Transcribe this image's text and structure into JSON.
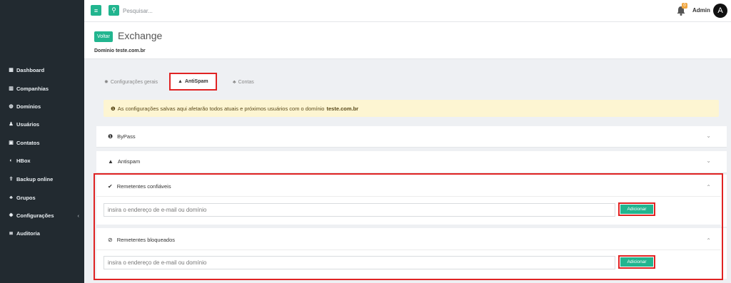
{
  "sidebar": {
    "items": [
      {
        "icon": "dashboard-icon",
        "glyph": "▦",
        "label": "Dashboard"
      },
      {
        "icon": "building-icon",
        "glyph": "▥",
        "label": "Companhias"
      },
      {
        "icon": "globe-icon",
        "glyph": "◍",
        "label": "Domínios"
      },
      {
        "icon": "user-icon",
        "glyph": "♟",
        "label": "Usuários"
      },
      {
        "icon": "address-card-icon",
        "glyph": "▣",
        "label": "Contatos"
      },
      {
        "icon": "hbox-icon",
        "glyph": "◐",
        "label": "HBox"
      },
      {
        "icon": "upload-icon",
        "glyph": "⇪",
        "label": "Backup online"
      },
      {
        "icon": "users-icon",
        "glyph": "♣",
        "label": "Grupos"
      },
      {
        "icon": "gear-icon",
        "glyph": "✹",
        "label": "Configurações",
        "chevron": "‹"
      },
      {
        "icon": "list-icon",
        "glyph": "≣",
        "label": "Auditoria"
      }
    ]
  },
  "topbar": {
    "menu_glyph": "≡",
    "search_glyph": "⚲",
    "search_placeholder": "Pesquisar...",
    "notification_count": "0",
    "user_name": "Admin",
    "avatar_letter": "A"
  },
  "header": {
    "back_label": "Voltar",
    "title": "Exchange",
    "domain_line": "Domínio teste.com.br"
  },
  "tabs": [
    {
      "icon": "gear-icon",
      "glyph": "✹",
      "label": "Configurações gerais",
      "active": false
    },
    {
      "icon": "warning-icon",
      "glyph": "▲",
      "label": "AntiSpam",
      "active": true
    },
    {
      "icon": "users-icon",
      "glyph": "♣",
      "label": "Contas",
      "active": false
    }
  ],
  "alert": {
    "glyph": "❶",
    "text": "As configurações salvas aqui afetarão todos atuais e próximos usuários com o domínio",
    "domain": "teste.com.br"
  },
  "panels": {
    "bypass": {
      "glyph": "❶",
      "title": "ByPass",
      "chevron": "⌄"
    },
    "antispam": {
      "glyph": "▲",
      "title": "Antispam",
      "chevron": "⌄"
    },
    "trusted": {
      "glyph": "✔",
      "title": "Remetentes confiáveis",
      "chevron": "⌃",
      "placeholder": "insira o endereço de e-mail ou domínio",
      "button": "Adicionar"
    },
    "blocked": {
      "glyph": "⊘",
      "title": "Remetentes bloqueados",
      "chevron": "⌃",
      "placeholder": "insira o endereço de e-mail ou domínio",
      "button": "Adicionar"
    }
  }
}
